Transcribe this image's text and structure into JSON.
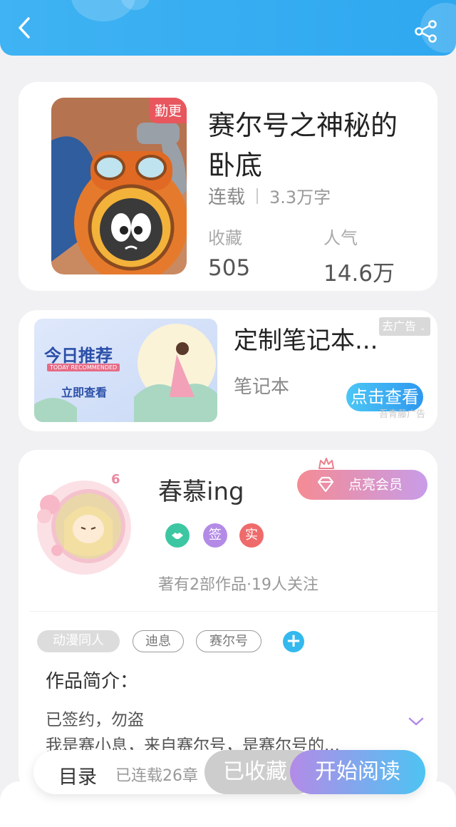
{
  "header": {
    "back_icon": "chevron-left-icon",
    "share_icon": "share-icon",
    "accent": "#3fb3f3"
  },
  "book": {
    "badge": "勤更",
    "title": "赛尔号之神秘的卧底",
    "status": "连载",
    "word_count": "3.3万字",
    "favorites_label": "收藏",
    "favorites_value": "505",
    "popularity_label": "人气",
    "popularity_value": "14.6万"
  },
  "ad": {
    "image_title": "今日推荐",
    "image_subtitle": "TODAY RECOMMENDED",
    "image_cta": "立即查看",
    "title": "定制笔记本...",
    "subtitle": "笔记本",
    "close_label": "去广告",
    "cta": "点击查看",
    "source": "吾青藤广告"
  },
  "author": {
    "level": "6",
    "name": "春慕ing",
    "vip_button": "点亮会员",
    "badges": [
      {
        "icon": "handshake-icon",
        "text": "",
        "color": "#3cc7a2"
      },
      {
        "icon": "signed-icon",
        "text": "签",
        "color": "#b38be7"
      },
      {
        "icon": "verified-icon",
        "text": "实",
        "color": "#ef6b6b"
      }
    ],
    "stats": "著有2部作品·19人关注"
  },
  "tags": [
    "动漫同人",
    "迪息",
    "赛尔号"
  ],
  "intro": {
    "heading": "作品简介：",
    "line1": "已签约，勿盗",
    "line2": "我是赛小息，来自赛尔号，是赛尔号的..."
  },
  "bottom_bar": {
    "toc": "目录",
    "serial": "已连载26章",
    "collected": "已收藏",
    "read": "开始阅读"
  }
}
